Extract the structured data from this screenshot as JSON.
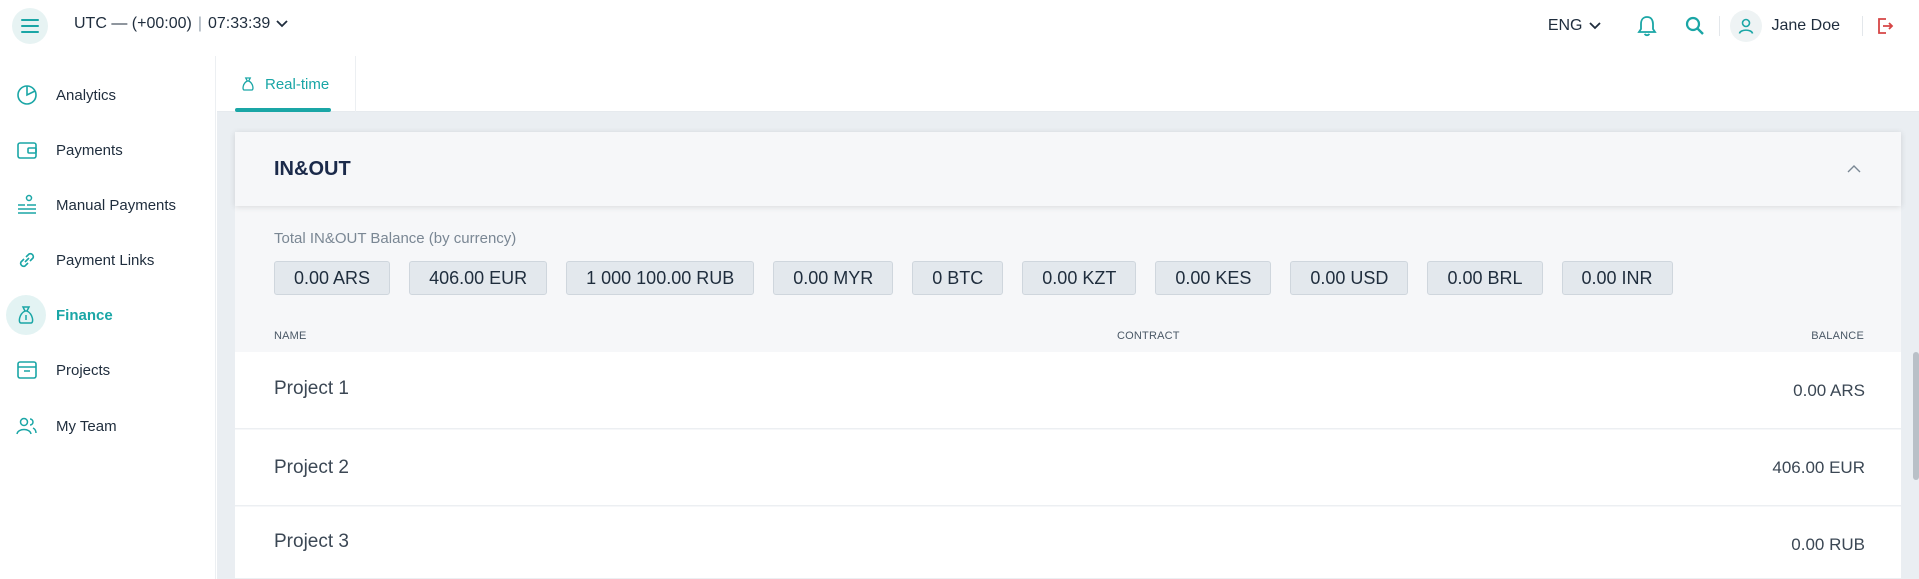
{
  "header": {
    "timezone": "UTC — (+00:00)",
    "time": "07:33:39",
    "language": "ENG",
    "user_name": "Jane Doe"
  },
  "sidebar": {
    "items": [
      {
        "label": "Analytics",
        "icon": "pie-chart-icon"
      },
      {
        "label": "Payments",
        "icon": "wallet-icon"
      },
      {
        "label": "Manual Payments",
        "icon": "hand-coins-icon"
      },
      {
        "label": "Payment Links",
        "icon": "link-icon"
      },
      {
        "label": "Finance",
        "icon": "money-bag-icon",
        "active": true
      },
      {
        "label": "Projects",
        "icon": "archive-box-icon"
      },
      {
        "label": "My Team",
        "icon": "team-icon"
      }
    ]
  },
  "tabs": [
    {
      "label": "Real-time",
      "active": true
    }
  ],
  "card": {
    "title": "IN&OUT",
    "balance_label": "Total IN&OUT Balance (by currency)",
    "balances": [
      "0.00 ARS",
      "406.00 EUR",
      "1 000 100.00 RUB",
      "0.00 MYR",
      "0 BTC",
      "0.00 KZT",
      "0.00 KES",
      "0.00 USD",
      "0.00 BRL",
      "0.00 INR"
    ],
    "columns": {
      "name": "NAME",
      "contract": "CONTRACT",
      "balance": "BALANCE"
    },
    "rows": [
      {
        "name": "Project 1",
        "contract": "",
        "balance": "0.00 ARS"
      },
      {
        "name": "Project 2",
        "contract": "",
        "balance": "406.00 EUR"
      },
      {
        "name": "Project 3",
        "contract": "",
        "balance": "0.00 RUB"
      }
    ]
  },
  "colors": {
    "accent": "#1aa6a6",
    "logout": "#d64545"
  }
}
